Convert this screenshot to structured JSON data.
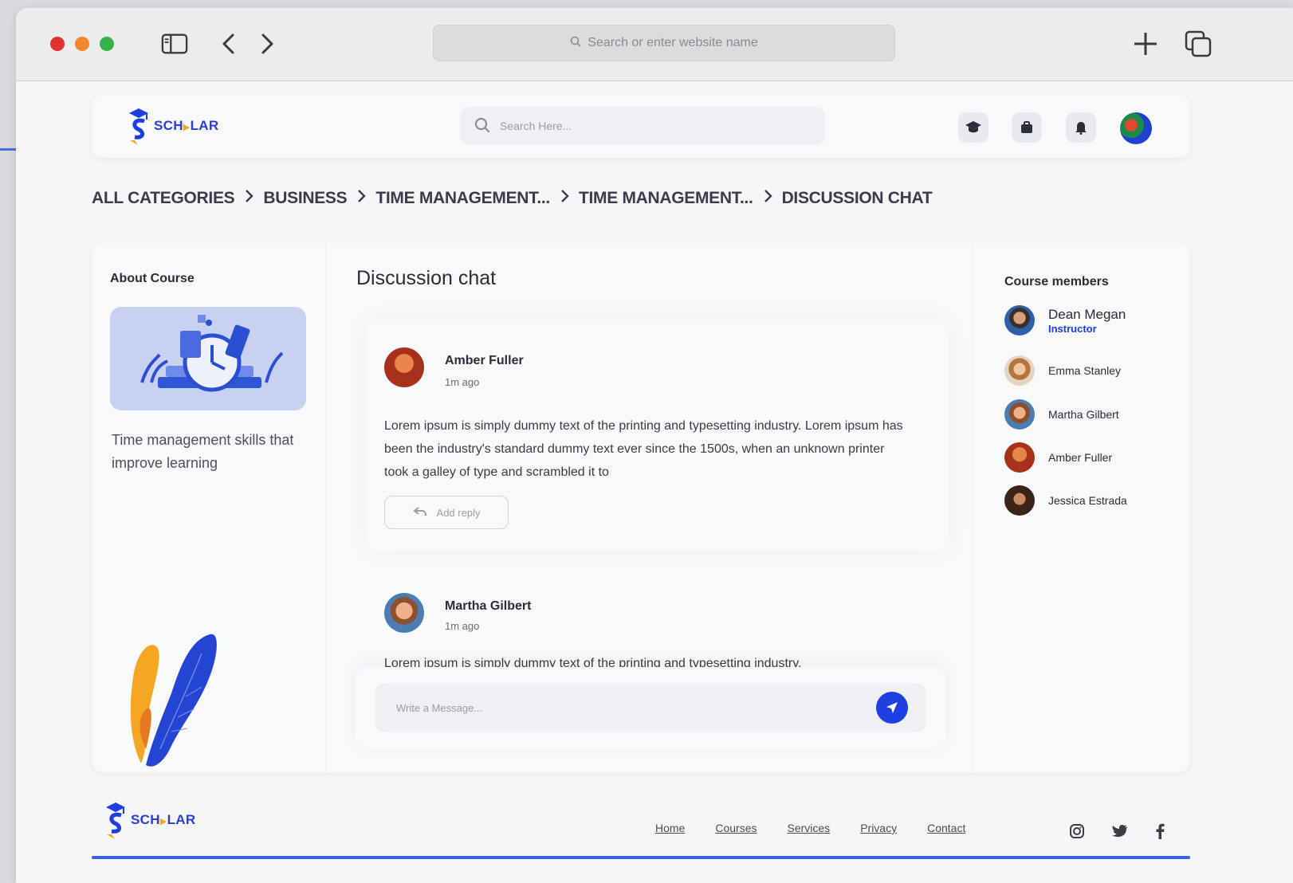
{
  "browser": {
    "address_placeholder": "Search or enter website name"
  },
  "brand": {
    "name": "SCHOLAR",
    "name_left": "SCH",
    "name_right": "LAR",
    "accent": "#1e3fe0",
    "secondary": "#f5a623"
  },
  "header": {
    "search_placeholder": "Search Here...",
    "icons": [
      "graduation-cap-icon",
      "bag-icon",
      "bell-icon"
    ]
  },
  "breadcrumb": [
    "ALL CATEGORIES",
    "BUSINESS",
    "TIME MANAGEMENT...",
    "TIME MANAGEMENT...",
    "DISCUSSION CHAT"
  ],
  "about": {
    "title": "About Course",
    "caption": "Time management skills that improve learning"
  },
  "chat": {
    "title": "Discussion chat",
    "messages": [
      {
        "author": "Amber Fuller",
        "time": "1m ago",
        "text": "Lorem ipsum is simply dummy text of the printing and typesetting industry. Lorem ipsum has been the industry's standard dummy text ever since the 1500s, when an unknown printer took a galley of type and scrambled it to",
        "reply_label": "Add reply"
      },
      {
        "author": "Martha Gilbert",
        "time": "1m ago",
        "text": "Lorem ipsum is simply dummy text of the printing and typesetting industry."
      }
    ],
    "composer_placeholder": "Write a Message..."
  },
  "members": {
    "title": "Course members",
    "list": [
      {
        "name": "Dean Megan",
        "role": "Instructor"
      },
      {
        "name": "Emma Stanley"
      },
      {
        "name": "Martha Gilbert"
      },
      {
        "name": "Amber Fuller"
      },
      {
        "name": "Jessica Estrada"
      }
    ]
  },
  "footer": {
    "links": [
      "Home",
      "Courses",
      "Services",
      "Privacy",
      "Contact"
    ],
    "social": [
      "instagram-icon",
      "twitter-icon",
      "facebook-icon"
    ]
  }
}
